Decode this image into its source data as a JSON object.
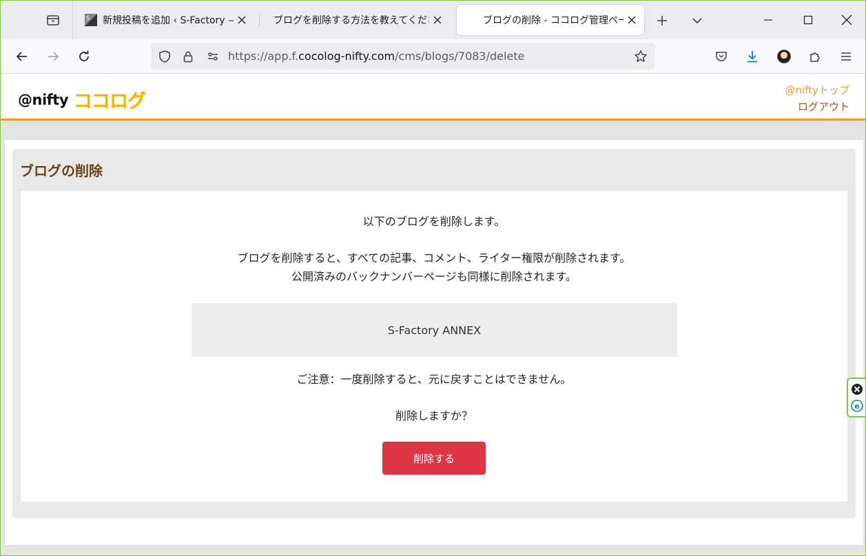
{
  "browser": {
    "tabs": [
      {
        "title": "新規投稿を追加 ‹ S-Factory — W",
        "active": false
      },
      {
        "title": "ブログを削除する方法を教えてください |",
        "active": false
      },
      {
        "title": "ブログの削除 - ココログ管理ページ",
        "active": true
      }
    ],
    "url": {
      "prefix": "https://app.f.",
      "domain": "cocolog-nifty.com",
      "path": "/cms/blogs/7083/delete"
    },
    "icons": {
      "tab_list": "tab-list-icon",
      "back": "back-arrow-icon",
      "forward": "forward-arrow-icon",
      "reload": "reload-icon",
      "shield": "shield-icon",
      "lock": "lock-icon",
      "permissions": "permissions-icon",
      "bookmark": "star-icon",
      "pocket": "pocket-icon",
      "downloads": "download-icon",
      "account": "avatar",
      "extensions": "puzzle-icon",
      "menu": "hamburger-menu-icon"
    }
  },
  "site": {
    "logo_nifty": "@nifty",
    "logo_cocolog": "ココログ",
    "link_top": "@niftyトップ",
    "link_logout": "ログアウト"
  },
  "main": {
    "title": "ブログの削除",
    "intro": "以下のブログを削除します。",
    "warning_line1": "ブログを削除すると、すべての記事、コメント、ライター権限が削除されます。",
    "warning_line2": "公開済みのバックナンバーページも同様に削除されます。",
    "blog_name": "S-Factory ANNEX",
    "caution": "ご注意：一度削除すると、元に戻すことはできません。",
    "confirm": "削除しますか？",
    "delete_button": "削除する"
  },
  "colors": {
    "accent_orange": "#f0963c",
    "title_brown": "#6b4314",
    "delete_red": "#dc3545",
    "logo_yellow": "#f7b500",
    "window_border": "#7ec54a"
  }
}
